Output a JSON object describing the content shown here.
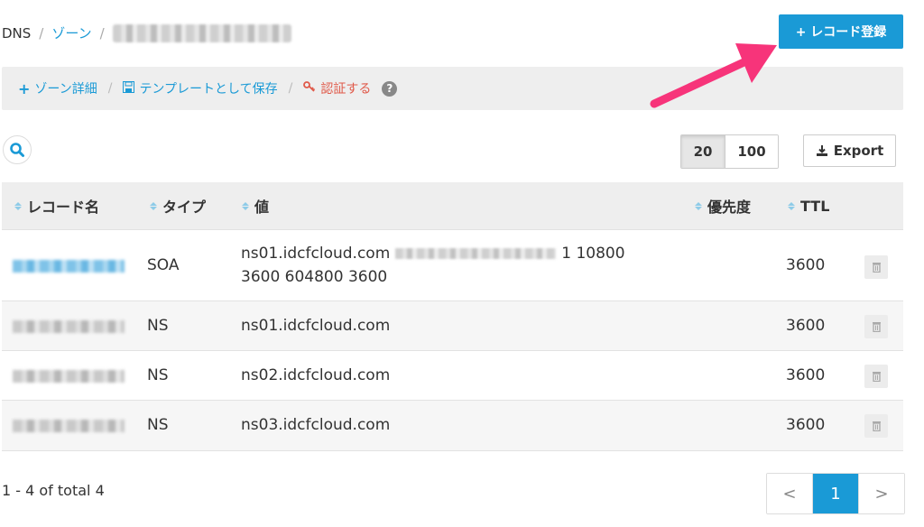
{
  "breadcrumb": {
    "root": "DNS",
    "sep": "/",
    "zone": "ゾーン"
  },
  "primary_button": {
    "label": "+ レコード登録"
  },
  "actions": {
    "zone_detail": "ゾーン詳細",
    "save_template": "テンプレートとして保存",
    "authenticate": "認証する",
    "help": "?"
  },
  "page_size": {
    "options": [
      "20",
      "100"
    ],
    "selected": "20"
  },
  "export_label": "Export",
  "table": {
    "headers": {
      "name": "レコード名",
      "type": "タイプ",
      "value": "値",
      "priority": "優先度",
      "ttl": "TTL"
    },
    "rows": [
      {
        "type": "SOA",
        "value_pre": "ns01.idcfcloud.com",
        "value_post": "1 10800",
        "value_line2": "3600 604800 3600",
        "priority": "",
        "ttl": "3600"
      },
      {
        "type": "NS",
        "value": "ns01.idcfcloud.com",
        "priority": "",
        "ttl": "3600"
      },
      {
        "type": "NS",
        "value": "ns02.idcfcloud.com",
        "priority": "",
        "ttl": "3600"
      },
      {
        "type": "NS",
        "value": "ns03.idcfcloud.com",
        "priority": "",
        "ttl": "3600"
      }
    ]
  },
  "pagination": {
    "summary": "1 - 4 of total 4",
    "prev": "<",
    "current": "1",
    "next": ">"
  },
  "colors": {
    "accent": "#1a9ad6",
    "danger": "#e05a4a",
    "annotation_arrow": "#f7347a"
  },
  "icons": [
    "search-icon",
    "plus-icon",
    "floppy-icon",
    "key-icon",
    "help-icon",
    "download-icon",
    "sort-icon",
    "trash-icon"
  ]
}
